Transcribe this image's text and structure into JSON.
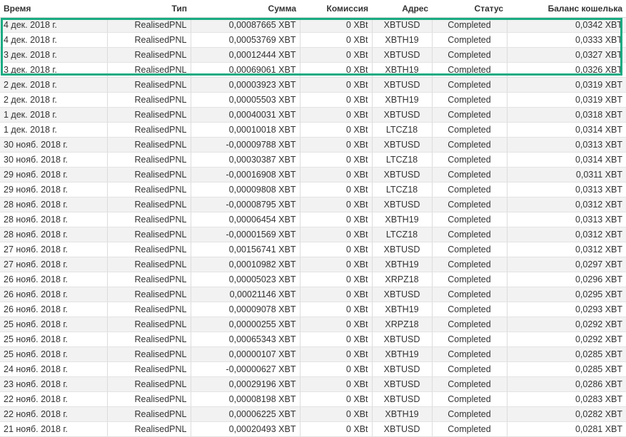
{
  "columns": [
    "Время",
    "Тип",
    "Сумма",
    "Комиссия",
    "Адрес",
    "Статус",
    "Баланс кошелька"
  ],
  "highlight_color": "#1aab82",
  "rows": [
    [
      "4 дек. 2018 г.",
      "RealisedPNL",
      "0,00087665 XBT",
      "0 XBt",
      "XBTUSD",
      "Completed",
      "0,0342 XBT"
    ],
    [
      "4 дек. 2018 г.",
      "RealisedPNL",
      "0,00053769 XBT",
      "0 XBt",
      "XBTH19",
      "Completed",
      "0,0333 XBT"
    ],
    [
      "3 дек. 2018 г.",
      "RealisedPNL",
      "0,00012444 XBT",
      "0 XBt",
      "XBTUSD",
      "Completed",
      "0,0327 XBT"
    ],
    [
      "3 дек. 2018 г.",
      "RealisedPNL",
      "0,00069061 XBT",
      "0 XBt",
      "XBTH19",
      "Completed",
      "0,0326 XBT"
    ],
    [
      "2 дек. 2018 г.",
      "RealisedPNL",
      "0,00003923 XBT",
      "0 XBt",
      "XBTUSD",
      "Completed",
      "0,0319 XBT"
    ],
    [
      "2 дек. 2018 г.",
      "RealisedPNL",
      "0,00005503 XBT",
      "0 XBt",
      "XBTH19",
      "Completed",
      "0,0319 XBT"
    ],
    [
      "1 дек. 2018 г.",
      "RealisedPNL",
      "0,00040031 XBT",
      "0 XBt",
      "XBTUSD",
      "Completed",
      "0,0318 XBT"
    ],
    [
      "1 дек. 2018 г.",
      "RealisedPNL",
      "0,00010018 XBT",
      "0 XBt",
      "LTCZ18",
      "Completed",
      "0,0314 XBT"
    ],
    [
      "30 нояб. 2018 г.",
      "RealisedPNL",
      "-0,00009788 XBT",
      "0 XBt",
      "XBTUSD",
      "Completed",
      "0,0313 XBT"
    ],
    [
      "30 нояб. 2018 г.",
      "RealisedPNL",
      "0,00030387 XBT",
      "0 XBt",
      "LTCZ18",
      "Completed",
      "0,0314 XBT"
    ],
    [
      "29 нояб. 2018 г.",
      "RealisedPNL",
      "-0,00016908 XBT",
      "0 XBt",
      "XBTUSD",
      "Completed",
      "0,0311 XBT"
    ],
    [
      "29 нояб. 2018 г.",
      "RealisedPNL",
      "0,00009808 XBT",
      "0 XBt",
      "LTCZ18",
      "Completed",
      "0,0313 XBT"
    ],
    [
      "28 нояб. 2018 г.",
      "RealisedPNL",
      "-0,00008795 XBT",
      "0 XBt",
      "XBTUSD",
      "Completed",
      "0,0312 XBT"
    ],
    [
      "28 нояб. 2018 г.",
      "RealisedPNL",
      "0,00006454 XBT",
      "0 XBt",
      "XBTH19",
      "Completed",
      "0,0313 XBT"
    ],
    [
      "28 нояб. 2018 г.",
      "RealisedPNL",
      "-0,00001569 XBT",
      "0 XBt",
      "LTCZ18",
      "Completed",
      "0,0312 XBT"
    ],
    [
      "27 нояб. 2018 г.",
      "RealisedPNL",
      "0,00156741 XBT",
      "0 XBt",
      "XBTUSD",
      "Completed",
      "0,0312 XBT"
    ],
    [
      "27 нояб. 2018 г.",
      "RealisedPNL",
      "0,00010982 XBT",
      "0 XBt",
      "XBTH19",
      "Completed",
      "0,0297 XBT"
    ],
    [
      "26 нояб. 2018 г.",
      "RealisedPNL",
      "0,00005023 XBT",
      "0 XBt",
      "XRPZ18",
      "Completed",
      "0,0296 XBT"
    ],
    [
      "26 нояб. 2018 г.",
      "RealisedPNL",
      "0,00021146 XBT",
      "0 XBt",
      "XBTUSD",
      "Completed",
      "0,0295 XBT"
    ],
    [
      "26 нояб. 2018 г.",
      "RealisedPNL",
      "0,00009078 XBT",
      "0 XBt",
      "XBTH19",
      "Completed",
      "0,0293 XBT"
    ],
    [
      "25 нояб. 2018 г.",
      "RealisedPNL",
      "0,00000255 XBT",
      "0 XBt",
      "XRPZ18",
      "Completed",
      "0,0292 XBT"
    ],
    [
      "25 нояб. 2018 г.",
      "RealisedPNL",
      "0,00065343 XBT",
      "0 XBt",
      "XBTUSD",
      "Completed",
      "0,0292 XBT"
    ],
    [
      "25 нояб. 2018 г.",
      "RealisedPNL",
      "0,00000107 XBT",
      "0 XBt",
      "XBTH19",
      "Completed",
      "0,0285 XBT"
    ],
    [
      "24 нояб. 2018 г.",
      "RealisedPNL",
      "-0,00000627 XBT",
      "0 XBt",
      "XBTUSD",
      "Completed",
      "0,0285 XBT"
    ],
    [
      "23 нояб. 2018 г.",
      "RealisedPNL",
      "0,00029196 XBT",
      "0 XBt",
      "XBTUSD",
      "Completed",
      "0,0286 XBT"
    ],
    [
      "22 нояб. 2018 г.",
      "RealisedPNL",
      "0,00008198 XBT",
      "0 XBt",
      "XBTUSD",
      "Completed",
      "0,0283 XBT"
    ],
    [
      "22 нояб. 2018 г.",
      "RealisedPNL",
      "0,00006225 XBT",
      "0 XBt",
      "XBTH19",
      "Completed",
      "0,0282 XBT"
    ],
    [
      "21 нояб. 2018 г.",
      "RealisedPNL",
      "0,00020493 XBT",
      "0 XBt",
      "XBTUSD",
      "Completed",
      "0,0281 XBT"
    ]
  ]
}
